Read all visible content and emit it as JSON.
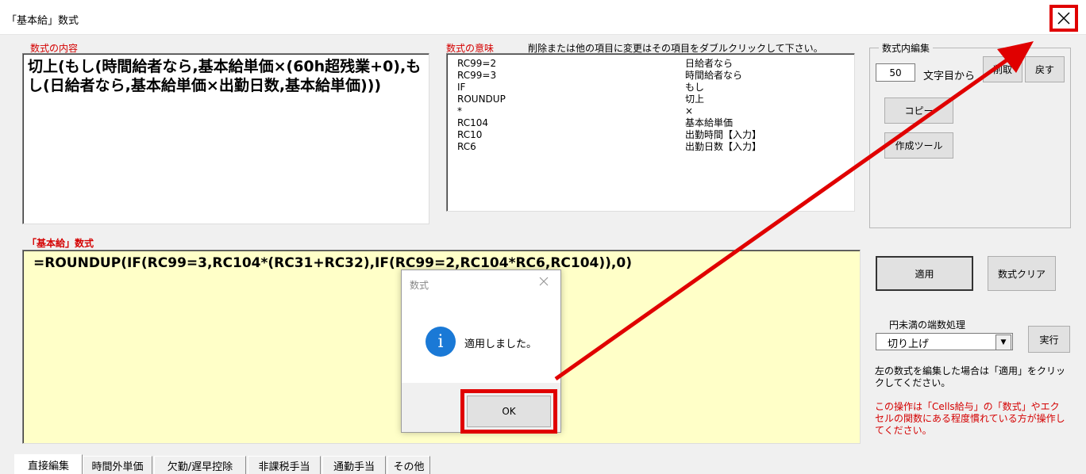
{
  "window": {
    "title": "「基本給」数式",
    "close_icon": "close-icon"
  },
  "content": {
    "label": "数式の内容",
    "text": "切上(もし(時間給者なら,基本給単価×(60h超残業+0),もし(日給者なら,基本給単価×出勤日数,基本給単価)))"
  },
  "meaning": {
    "label": "数式の意味",
    "hint": "削除または他の項目に変更はその項目をダブルクリックして下さい。",
    "rows": [
      {
        "code": "RC99=2",
        "meaning": "日給者なら"
      },
      {
        "code": "RC99=3",
        "meaning": "時間給者なら"
      },
      {
        "code": "IF",
        "meaning": "もし"
      },
      {
        "code": "ROUNDUP",
        "meaning": "切上"
      },
      {
        "code": "*",
        "meaning": "×"
      },
      {
        "code": "RC104",
        "meaning": "基本給単価"
      },
      {
        "code": "RC10",
        "meaning": "出勤時間【入力】"
      },
      {
        "code": "RC6",
        "meaning": "出勤日数【入力】"
      }
    ]
  },
  "edit_group": {
    "legend": "数式内編集",
    "position": "50",
    "position_label": "文字目から",
    "take_button": "削取",
    "back_button": "戻す",
    "copy_button": "コピー",
    "tool_button": "作成ツール"
  },
  "formula": {
    "label": "「基本給」数式",
    "text": "=ROUNDUP(IF(RC99=3,RC104*(RC31+RC32),IF(RC99=2,RC104*RC6,RC104)),0)"
  },
  "actions": {
    "apply_button": "適用",
    "clear_button": "数式クリア",
    "rounding_label": "円未満の端数処理",
    "rounding_value": "切り上げ",
    "execute_button": "実行",
    "note": "左の数式を編集した場合は「適用」をクリックしてください。",
    "warning": "この操作は「Cells給与」の「数式」やエクセルの関数にある程度慣れている方が操作してください。"
  },
  "tabs": [
    "直接編集",
    "時間外単価",
    "欠勤/遅早控除",
    "非課税手当",
    "通勤手当",
    "その他"
  ],
  "dialog": {
    "title": "数式",
    "icon": "info-icon",
    "message": "適用しました。",
    "ok_button": "OK"
  },
  "colors": {
    "highlight": "#e00000",
    "formula_bg": "#ffffc8",
    "info": "#1a79d6",
    "label_red": "#d40000"
  }
}
